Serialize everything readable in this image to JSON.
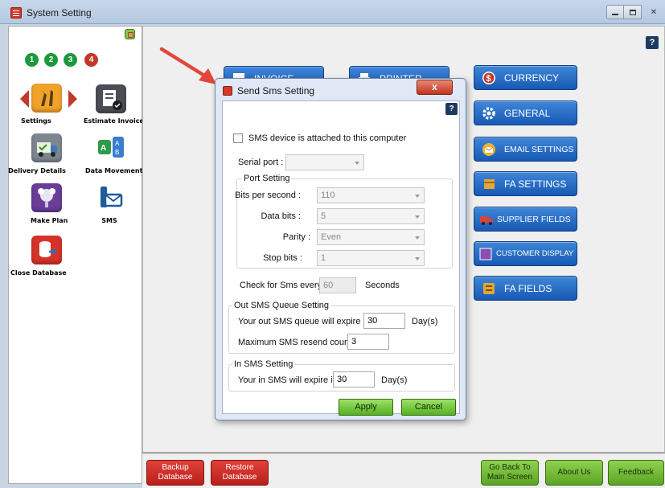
{
  "window": {
    "title": "System Setting",
    "close_glyph": "✕",
    "help_glyph": "?"
  },
  "steps": [
    "1",
    "2",
    "3",
    "4"
  ],
  "left_tiles": [
    {
      "label": "Settings",
      "color": "#f0a329",
      "icon": "wrench-icon"
    },
    {
      "label": "Estimate Invoice",
      "color": "#4a4f55",
      "icon": "invoice-icon"
    },
    {
      "label": "Delivery Details",
      "color": "#7d8791",
      "icon": "truck-icon"
    },
    {
      "label": "Data Movement",
      "color": "#ffffff",
      "icon": "sort-ab-icon"
    },
    {
      "label": "Make Plan",
      "color": "#6a3d99",
      "icon": "plan-icon"
    },
    {
      "label": "SMS",
      "color": "#ffffff",
      "icon": "sms-icon"
    },
    {
      "label": "Close Database",
      "color": "#d7322a",
      "icon": "database-icon"
    }
  ],
  "main_buttons": {
    "invoice": "INVOICE",
    "printer": "PRINTER",
    "currency": "CURRENCY",
    "general": "GENERAL",
    "email": "EMAIL SETTINGS",
    "fa_settings": "FA SETTINGS",
    "supplier": "SUPPLIER FIELDS",
    "customer": "CUSTOMER DISPLAY",
    "fa_fields": "FA FIELDS"
  },
  "bottom_buttons": {
    "backup": [
      "Backup",
      "Database"
    ],
    "restore": [
      "Restore",
      "Database"
    ],
    "go_back": [
      "Go Back To",
      "Main Screen"
    ],
    "about": "About Us",
    "feedback": "Feedback"
  },
  "dialog": {
    "title": "Send Sms Setting",
    "close_glyph": "x",
    "help_glyph": "?",
    "sms_device_label": "SMS device is attached to this computer",
    "sms_device_checked": false,
    "serial_port_label": "Serial port :",
    "serial_port_value": "",
    "port_setting": {
      "legend": "Port Setting",
      "bits_label": "Bits per second :",
      "bits_value": "110",
      "data_bits_label": "Data bits :",
      "data_bits_value": "5",
      "parity_label": "Parity :",
      "parity_value": "Even",
      "stop_bits_label": "Stop bits :",
      "stop_bits_value": "1"
    },
    "check_every_label": "Check for Sms every",
    "check_every_value": "60",
    "seconds_label": "Seconds",
    "out_queue": {
      "legend": "Out SMS Queue Setting",
      "expire_label": "Your out SMS queue will expire in",
      "expire_value": "30",
      "days_label": "Day(s)",
      "resend_label": "Maximum SMS resend count",
      "resend_value": "3"
    },
    "in_sms": {
      "legend": "In SMS Setting",
      "expire_label": "Your in SMS will expire in",
      "expire_value": "30",
      "days_label": "Day(s)"
    },
    "apply_label": "Apply",
    "cancel_label": "Cancel"
  },
  "colors": {
    "accent_blue": "#1f65c2",
    "danger_red": "#d23a2a",
    "success_green": "#6cbf2f",
    "pointer_red": "#e3463a"
  }
}
